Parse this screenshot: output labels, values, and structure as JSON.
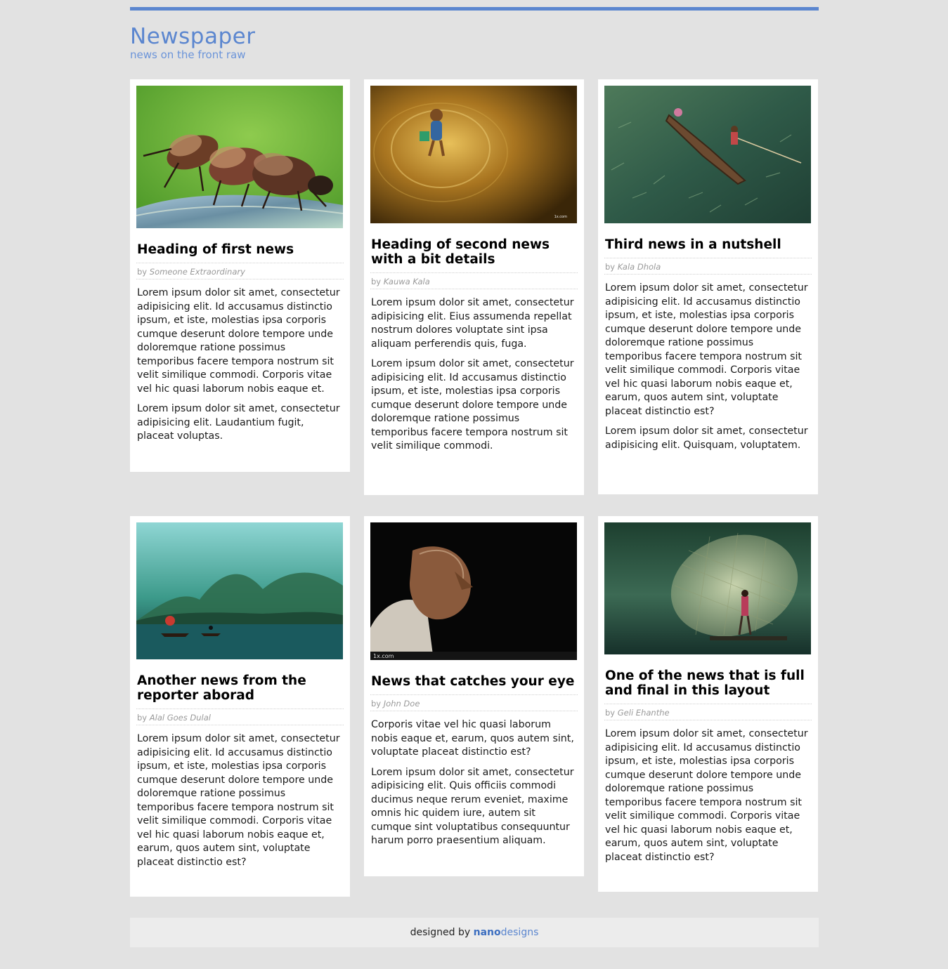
{
  "header": {
    "title": "Newspaper",
    "subtitle": "news on the front raw"
  },
  "articles": [
    {
      "image": "beetles-macro-photo",
      "heading": "Heading of first news",
      "by": "by",
      "author": "Someone Extraordinary",
      "paragraphs": [
        "Lorem ipsum dolor sit amet, consectetur adipisicing elit. Id accusamus distinctio ipsum, et iste, molestias ipsa corporis cumque deserunt dolore tempore unde doloremque ratione possimus temporibus facere tempora nostrum sit velit similique commodi. Corporis vitae vel hic quasi laborum nobis eaque et.",
        "Lorem ipsum dolor sit amet, consectetur adipisicing elit. Laudantium fugit, placeat voluptas."
      ]
    },
    {
      "image": "child-in-golden-water-photo",
      "heading": "Heading of second news with a bit details",
      "by": "by",
      "author": "Kauwa Kala",
      "paragraphs": [
        "Lorem ipsum dolor sit amet, consectetur adipisicing elit. Eius assumenda repellat nostrum dolores voluptate sint ipsa aliquam perferendis quis, fuga.",
        "Lorem ipsum dolor sit amet, consectetur adipisicing elit. Id accusamus distinctio ipsum, et iste, molestias ipsa corporis cumque deserunt dolore tempore unde doloremque ratione possimus temporibus facere tempora nostrum sit velit similique commodi."
      ]
    },
    {
      "image": "boat-over-green-water-photo",
      "heading": "Third news in a nutshell",
      "by": "by",
      "author": "Kala Dhola",
      "paragraphs": [
        "Lorem ipsum dolor sit amet, consectetur adipisicing elit. Id accusamus distinctio ipsum, et iste, molestias ipsa corporis cumque deserunt dolore tempore unde doloremque ratione possimus temporibus facere tempora nostrum sit velit similique commodi. Corporis vitae vel hic quasi laborum nobis eaque et, earum, quos autem sint, voluptate placeat distinctio est?",
        "Lorem ipsum dolor sit amet, consectetur adipisicing elit. Quisquam, voluptatem."
      ]
    },
    {
      "image": "misty-lake-boat-photo",
      "heading": "Another news from the reporter aborad",
      "by": "by",
      "author": "Alal Goes Dulal",
      "paragraphs": [
        "Lorem ipsum dolor sit amet, consectetur adipisicing elit. Id accusamus distinctio ipsum, et iste, molestias ipsa corporis cumque deserunt dolore tempore unde doloremque ratione possimus temporibus facere tempora nostrum sit velit similique commodi. Corporis vitae vel hic quasi laborum nobis eaque et, earum, quos autem sint, voluptate placeat distinctio est?"
      ]
    },
    {
      "image": "old-man-portrait-photo",
      "heading": "News that catches your eye",
      "by": "by",
      "author": "John Doe",
      "paragraphs": [
        "Corporis vitae vel hic quasi laborum nobis eaque et, earum, quos autem sint, voluptate placeat distinctio est?",
        "Lorem ipsum dolor sit amet, consectetur adipisicing elit. Quis officiis commodi ducimus neque rerum eveniet, maxime omnis hic quidem iure, autem sit cumque sint voluptatibus consequuntur harum porro praesentium aliquam."
      ]
    },
    {
      "image": "fisherman-casting-net-photo",
      "heading": "One of the news that is full and final in this layout",
      "by": "by",
      "author": "Geli Ehanthe",
      "paragraphs": [
        "Lorem ipsum dolor sit amet, consectetur adipisicing elit. Id accusamus distinctio ipsum, et iste, molestias ipsa corporis cumque deserunt dolore tempore unde doloremque ratione possimus temporibus facere tempora nostrum sit velit similique commodi. Corporis vitae vel hic quasi laborum nobis eaque et, earum, quos autem sint, voluptate placeat distinctio est?"
      ]
    }
  ],
  "footer": {
    "prefix": "designed by",
    "brand_a": "nano",
    "brand_b": "designs"
  },
  "colors": {
    "accent": "#5b86cf",
    "background": "#e2e2e2",
    "card": "#ffffff"
  }
}
